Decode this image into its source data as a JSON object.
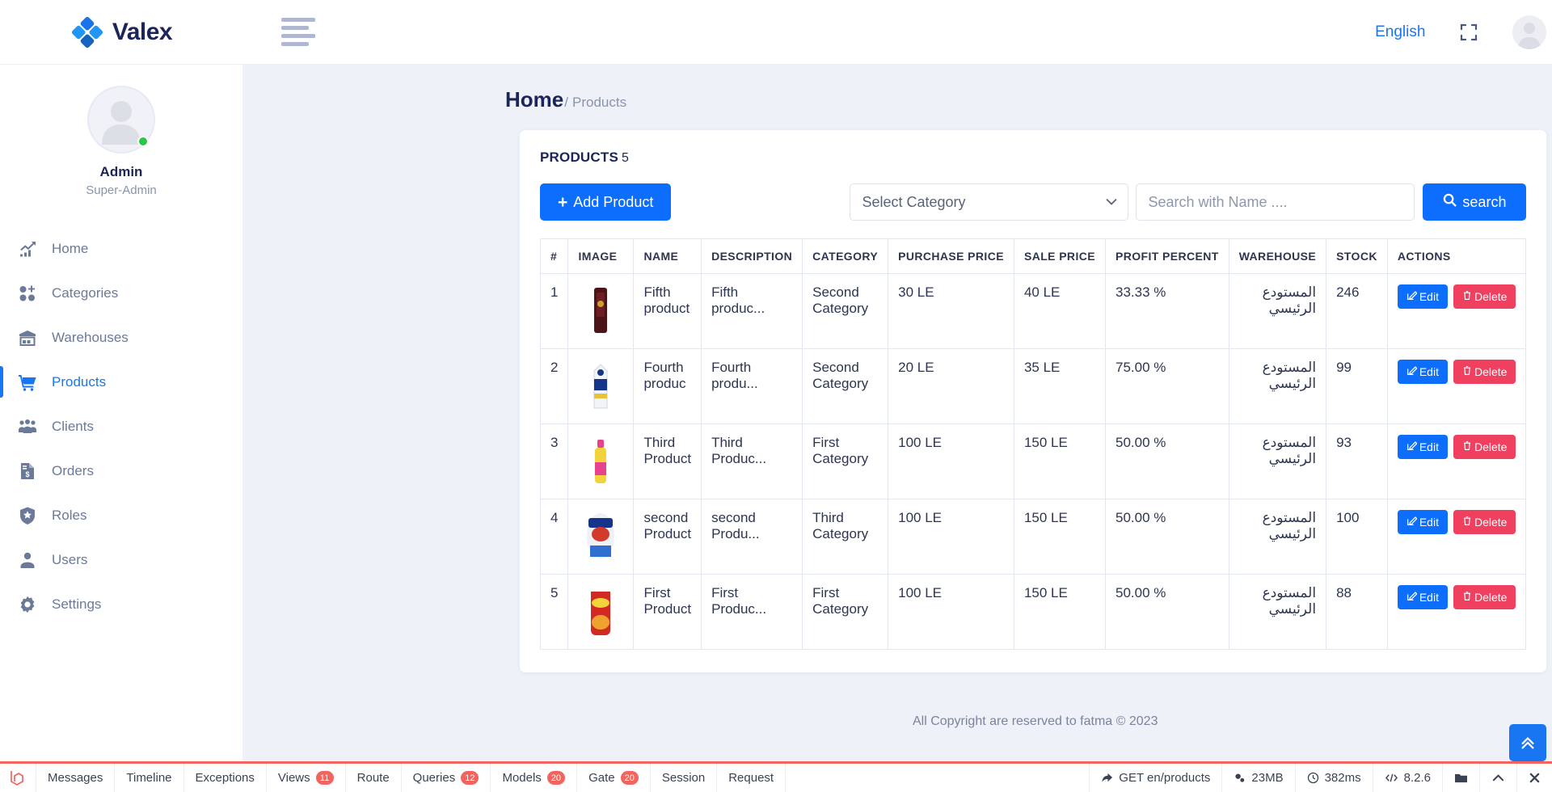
{
  "brand": {
    "name": "Valex"
  },
  "profile": {
    "name": "Admin",
    "role": "Super-Admin"
  },
  "sidebar": {
    "items": [
      {
        "label": "Home",
        "icon": "chart-growth-icon",
        "active": false
      },
      {
        "label": "Categories",
        "icon": "categories-add-icon",
        "active": false
      },
      {
        "label": "Warehouses",
        "icon": "warehouse-icon",
        "active": false
      },
      {
        "label": "Products",
        "icon": "cart-icon",
        "active": true
      },
      {
        "label": "Clients",
        "icon": "users-group-icon",
        "active": false
      },
      {
        "label": "Orders",
        "icon": "invoice-dollar-icon",
        "active": false
      },
      {
        "label": "Roles",
        "icon": "shield-star-icon",
        "active": false
      },
      {
        "label": "Users",
        "icon": "user-icon",
        "active": false
      },
      {
        "label": "Settings",
        "icon": "gear-icon",
        "active": false
      }
    ]
  },
  "topbar": {
    "language": "English",
    "menu_icon": "hamburger-icon",
    "fullscreen_icon": "expand-icon",
    "avatar_icon": "user-avatar-icon"
  },
  "breadcrumb": {
    "home": "Home",
    "separator": "/",
    "current": "Products"
  },
  "card": {
    "title": "PRODUCTS",
    "count": "5",
    "add_button": "Add Product",
    "search_button": "search",
    "category_select": {
      "selected": "Select Category",
      "options": [
        "Select Category",
        "First Category",
        "Second Category",
        "Third Category"
      ]
    },
    "search_placeholder": "Search with Name ....",
    "search_value": ""
  },
  "table": {
    "headers": [
      "#",
      "IMAGE",
      "NAME",
      "DESCRIPTION",
      "CATEGORY",
      "PURCHASE PRICE",
      "SALE PRICE",
      "PROFIT PERCENT",
      "WAREHOUSE",
      "STOCK",
      "ACTIONS"
    ],
    "edit_label": "Edit",
    "delete_label": "Delete",
    "rows": [
      {
        "idx": "1",
        "name": "Fifth product",
        "description": "Fifth produc...",
        "category": "Second Category",
        "purchase_price": "30 LE",
        "sale_price": "40 LE",
        "profit_percent": "33.33 %",
        "warehouse": "المستودع الرئيسي",
        "stock": "246",
        "image": "dark-red-bottle"
      },
      {
        "idx": "2",
        "name": "Fourth produc",
        "description": "Fourth produ...",
        "category": "Second Category",
        "purchase_price": "20 LE",
        "sale_price": "35 LE",
        "profit_percent": "75.00 %",
        "warehouse": "المستودع الرئيسي",
        "stock": "99",
        "image": "blue-milk-carton"
      },
      {
        "idx": "3",
        "name": "Third Product",
        "description": "Third Produc...",
        "category": "First Category",
        "purchase_price": "100 LE",
        "sale_price": "150 LE",
        "profit_percent": "50.00 %",
        "warehouse": "المستودع الرئيسي",
        "stock": "93",
        "image": "pink-yellow-bottle"
      },
      {
        "idx": "4",
        "name": "second Product",
        "description": "second Produ...",
        "category": "Third Category",
        "purchase_price": "100 LE",
        "sale_price": "150 LE",
        "profit_percent": "50.00 %",
        "warehouse": "المستودع الرئيسي",
        "stock": "100",
        "image": "cow-dairy-pack"
      },
      {
        "idx": "5",
        "name": "First Product",
        "description": "First Produc...",
        "category": "First Category",
        "purchase_price": "100 LE",
        "sale_price": "150 LE",
        "profit_percent": "50.00 %",
        "warehouse": "المستودع الرئيسي",
        "stock": "88",
        "image": "red-chips-bag"
      }
    ]
  },
  "footer": {
    "copyright": "All Copyright are reserved to fatma © 2023"
  },
  "debugbar": {
    "tabs": [
      {
        "label": "Messages",
        "badge": ""
      },
      {
        "label": "Timeline",
        "badge": ""
      },
      {
        "label": "Exceptions",
        "badge": ""
      },
      {
        "label": "Views",
        "badge": "11"
      },
      {
        "label": "Route",
        "badge": ""
      },
      {
        "label": "Queries",
        "badge": "12"
      },
      {
        "label": "Models",
        "badge": "20"
      },
      {
        "label": "Gate",
        "badge": "20"
      },
      {
        "label": "Session",
        "badge": ""
      },
      {
        "label": "Request",
        "badge": ""
      }
    ],
    "request": "GET en/products",
    "memory": "23MB",
    "time": "382ms",
    "php_version": "8.2.6"
  },
  "colors": {
    "accent": "#1976f2",
    "primary_button": "#0d6efd",
    "danger": "#ef4060",
    "sidebar_text": "#6b7a99",
    "heading": "#1b2559",
    "debugbar_accent": "#f4645f",
    "online_status": "#28c745"
  }
}
